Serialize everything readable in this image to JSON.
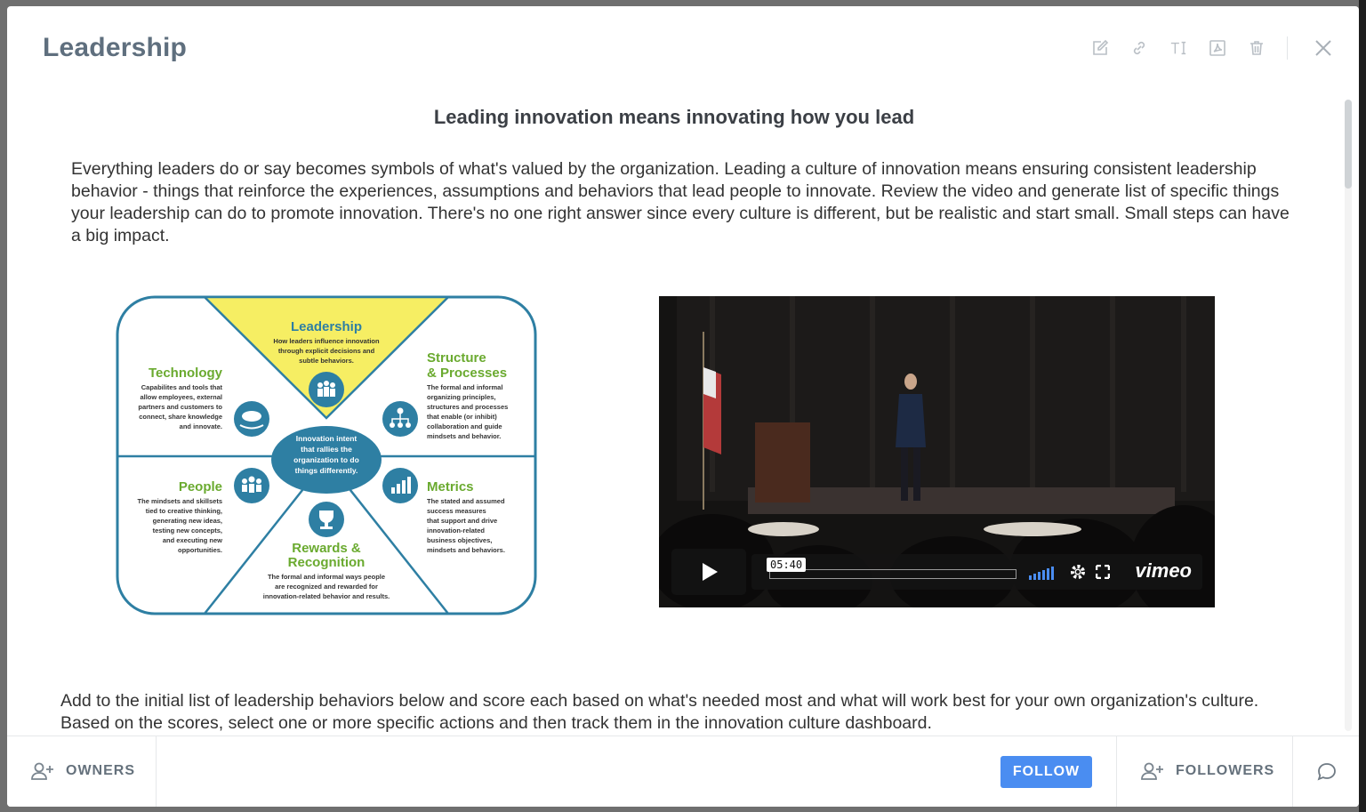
{
  "modal": {
    "title": "Leadership",
    "toolbar": [
      "edit-icon",
      "link-icon",
      "text-size-icon",
      "pdf-icon",
      "trash-icon",
      "close-icon"
    ]
  },
  "content": {
    "subtitle": "Leading innovation means innovating how you lead",
    "intro": "Everything leaders do or say becomes symbols of what's valued by the organization. Leading a culture of innovation means ensuring consistent leadership behavior - things that reinforce the experiences, assumptions and behaviors that lead people to innovate. Review the video and generate list of specific things your leadership can do to promote innovation. There's no one right answer since every culture is different, but be realistic and start small. Small steps can have a big impact.",
    "closing": "Add to the initial list of leadership behaviors below and score each based on what's needed most and what will work best for your own organization's culture. Based on the scores, select one or more specific actions and then track them in the innovation culture dashboard."
  },
  "diagram": {
    "center": [
      "Innovation intent",
      "that rallies the",
      "organization to do",
      "things differently."
    ],
    "leadership": {
      "title": "Leadership",
      "desc": [
        "How leaders influence innovation",
        "through explicit decisions and",
        "subtle behaviors."
      ]
    },
    "technology": {
      "title": "Technology",
      "desc": [
        "Capabilites and tools that",
        "allow employees, external",
        "partners and customers to",
        "connect, share knowledge",
        "and innovate."
      ]
    },
    "structure": {
      "title1": "Structure",
      "title2": "& Processes",
      "desc": [
        "The formal and informal",
        "organizing principles,",
        "structures and processes",
        "that enable (or inhibit)",
        "collaboration and guide",
        "mindsets and behavior."
      ]
    },
    "people": {
      "title": "People",
      "desc": [
        "The mindsets and skillsets",
        "tied to creative thinking,",
        "generating new ideas,",
        "testing new concepts,",
        "and executing new",
        "opportunities."
      ]
    },
    "metrics": {
      "title": "Metrics",
      "desc": [
        "The stated and assumed",
        "success measures",
        "that support and drive",
        "innovation-related",
        "business objectives,",
        "mindsets and behaviors."
      ]
    },
    "rewards": {
      "title1": "Rewards &",
      "title2": "Recognition",
      "desc": [
        "The formal and informal ways people",
        "are recognized and rewarded for",
        "innovation-related behavior and results."
      ]
    }
  },
  "video": {
    "time": "05:40",
    "brand": "vimeo"
  },
  "footer": {
    "owners": "OWNERS",
    "follow": "FOLLOW",
    "followers": "FOLLOWERS"
  }
}
